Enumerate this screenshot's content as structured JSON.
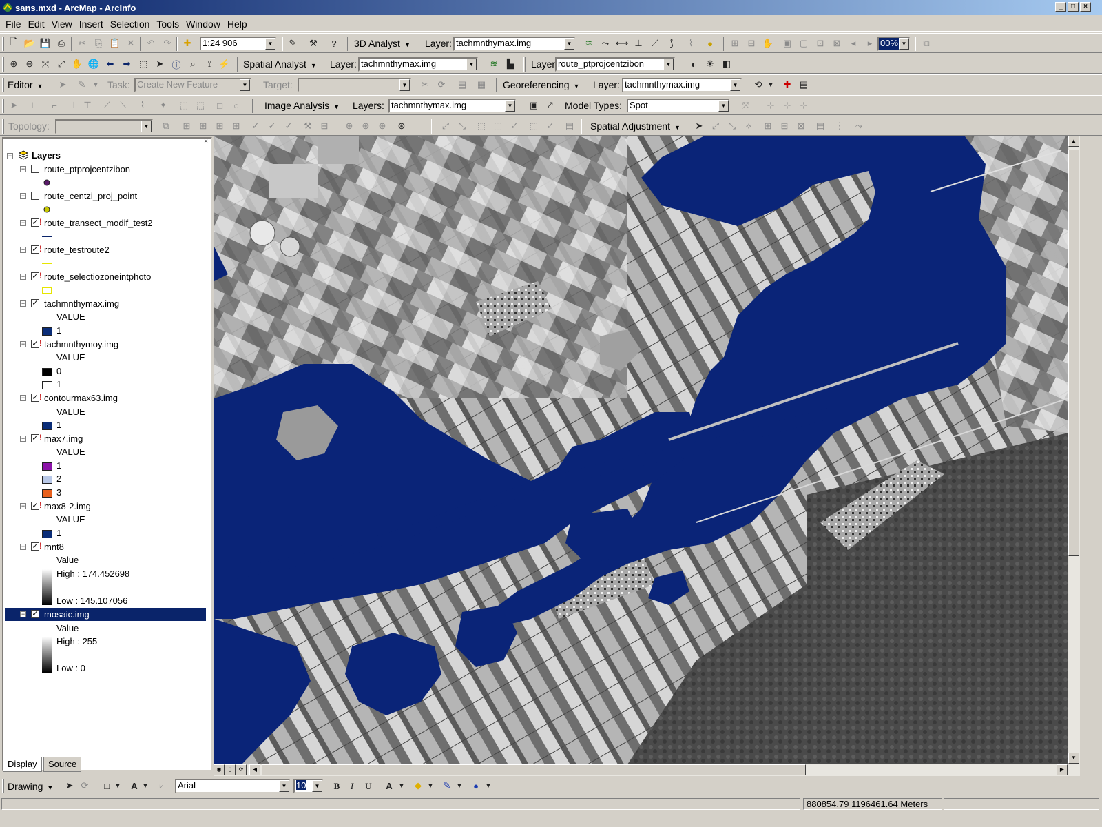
{
  "window": {
    "title": "sans.mxd - ArcMap - ArcInfo"
  },
  "menu": [
    "File",
    "Edit",
    "View",
    "Insert",
    "Selection",
    "Tools",
    "Window",
    "Help"
  ],
  "toolbar1": {
    "scale": "1:24 906",
    "analyst_menu": "3D Analyst",
    "layer_label": "Layer:",
    "layer_value": "tachmnthymax.img",
    "zoom_value": "00%"
  },
  "toolbar2": {
    "spatial_analyst": "Spatial Analyst",
    "layer_label": "Layer:",
    "layer_value": "tachmnthymax.img",
    "layer2_label": "Layer",
    "layer2_value": "route_ptprojcentzibon"
  },
  "toolbar3": {
    "editor": "Editor",
    "task_label": "Task:",
    "task_value": "Create New Feature",
    "target_label": "Target:",
    "georeferencing": "Georeferencing",
    "layer_label": "Layer:",
    "layer_value": "tachmnthymax.img"
  },
  "toolbar4": {
    "image_analysis": "Image Analysis",
    "layers_label": "Layers:",
    "layers_value": "tachmnthymax.img",
    "model_types_label": "Model Types:",
    "model_types_value": "Spot"
  },
  "toolbar5": {
    "topology": "Topology:",
    "spatial_adjustment": "Spatial Adjustment"
  },
  "toc": {
    "root": "Layers",
    "tabs": [
      "Display",
      "Source"
    ],
    "layers": [
      {
        "name": "route_ptprojcentzibon",
        "checked": false
      },
      {
        "name": "route_centzi_proj_point",
        "checked": false
      },
      {
        "name": "route_transect_modif_test2",
        "checked": true
      },
      {
        "name": "route_testroute2",
        "checked": true
      },
      {
        "name": "route_selectiozoneintphoto",
        "checked": true
      },
      {
        "name": "tachmnthymax.img",
        "checked": true,
        "heading": "VALUE",
        "classes": [
          {
            "label": "1",
            "color": "#0a2d78"
          }
        ]
      },
      {
        "name": "tachmnthymoy.img",
        "checked": true,
        "heading": "VALUE",
        "classes": [
          {
            "label": "0",
            "color": "#000000"
          },
          {
            "label": "1",
            "color": "#ffffff"
          }
        ]
      },
      {
        "name": "contourmax63.img",
        "checked": true,
        "heading": "VALUE",
        "classes": [
          {
            "label": "1",
            "color": "#0a2d78"
          }
        ]
      },
      {
        "name": "max7.img",
        "checked": true,
        "heading": "VALUE",
        "classes": [
          {
            "label": "1",
            "color": "#8b12a8"
          },
          {
            "label": "2",
            "color": "#b8c8e8"
          },
          {
            "label": "3",
            "color": "#e8601c"
          }
        ]
      },
      {
        "name": "max8-2.img",
        "checked": true,
        "heading": "VALUE",
        "classes": [
          {
            "label": "1",
            "color": "#0a2d78"
          }
        ]
      },
      {
        "name": "mnt8",
        "checked": true,
        "heading": "Value",
        "high": "High : 174.452698",
        "low": "Low : 145.107056"
      },
      {
        "name": "mosaic.img",
        "checked": true,
        "heading": "Value",
        "high": "High : 255",
        "low": "Low : 0"
      }
    ]
  },
  "drawing": {
    "menu": "Drawing",
    "font": "Arial",
    "size": "10",
    "bold": "B",
    "italic": "I",
    "underline": "U"
  },
  "status": {
    "coords": "880854.79  1196461.64 Meters"
  },
  "map": {
    "water_color": "#0a2478"
  }
}
